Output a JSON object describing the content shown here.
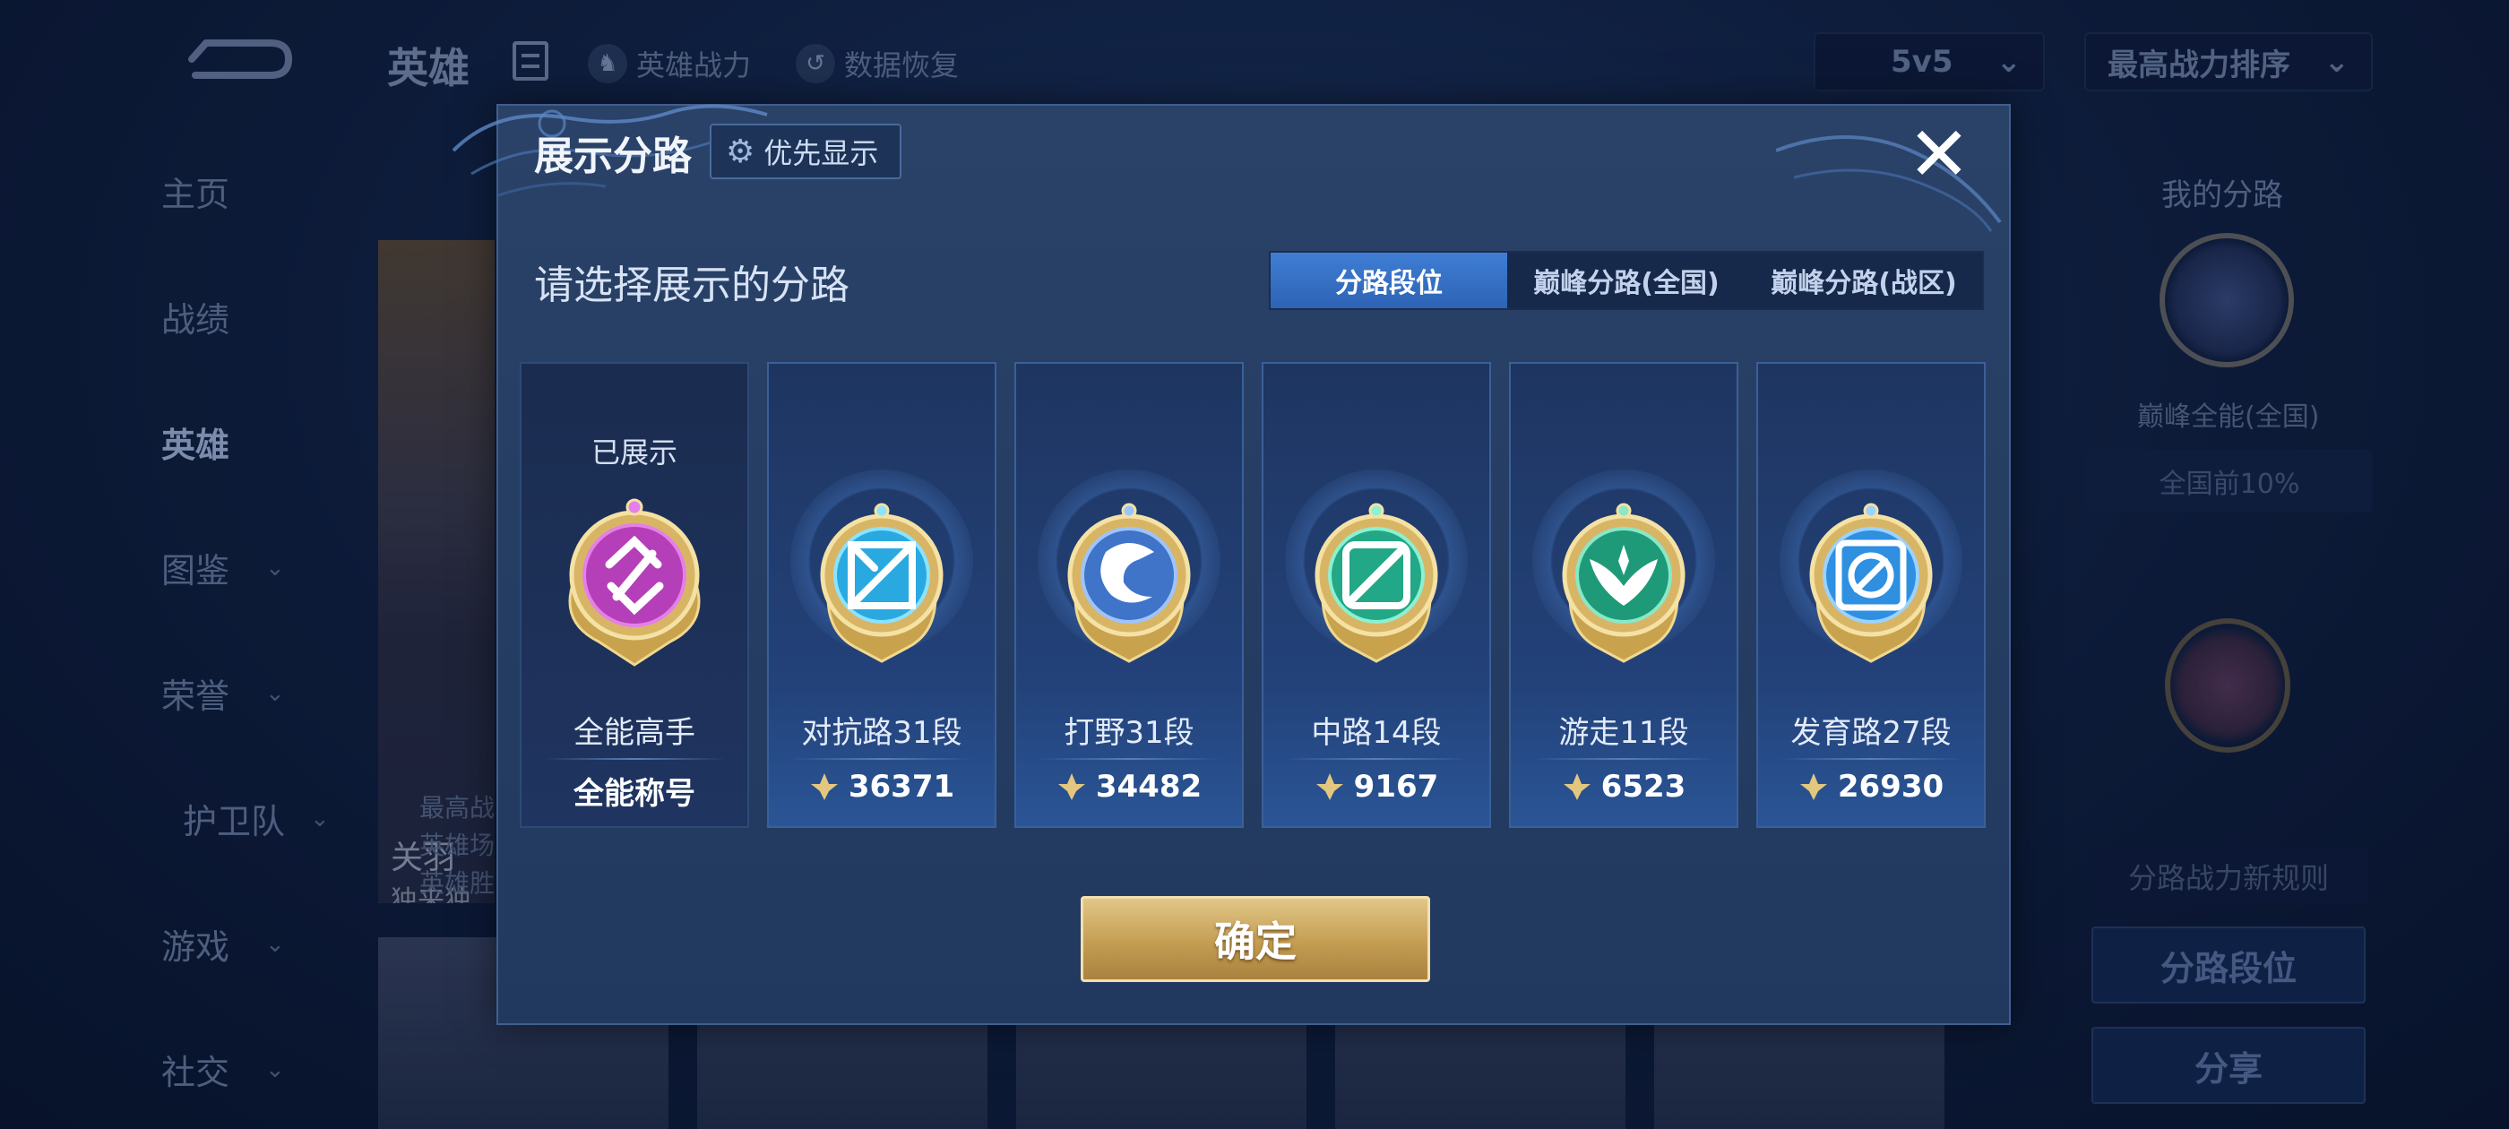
{
  "background": {
    "title": "英雄",
    "links": [
      "英雄战力",
      "数据恢复"
    ],
    "mode_select": "5v5",
    "sort_select": "最高战力排序",
    "nav": [
      {
        "label": "主页"
      },
      {
        "label": "战绩"
      },
      {
        "label": "英雄"
      },
      {
        "label": "图鉴"
      },
      {
        "label": "荣誉"
      },
      {
        "label": "护卫队"
      },
      {
        "label": "游戏"
      },
      {
        "label": "社交"
      }
    ],
    "hero_card": {
      "name": "关羽",
      "subtitle": "独来独往"
    },
    "hero_stats": [
      "最高战",
      "英雄场",
      "英雄胜"
    ],
    "right_panel": {
      "title": "我的分路",
      "badge_label": "巅峰全能(全国)",
      "rank_pill": "全国前10%",
      "rule_link": "分路战力新规则",
      "btn_lane_rank": "分路段位",
      "btn_share": "分享"
    }
  },
  "modal": {
    "title": "展示分路",
    "priority_button": "优先显示",
    "prompt": "请选择展示的分路",
    "tabs": [
      "分路段位",
      "巅峰分路(全国)",
      "巅峰分路(战区)"
    ],
    "active_tab": 0,
    "cards": [
      {
        "status": "已展示",
        "label": "全能高手",
        "value": "全能称号",
        "color": "#b53fb8",
        "icon": "all-round-medal-icon"
      },
      {
        "status": "",
        "label": "对抗路31段",
        "value": "36371",
        "color": "#2aa9e0",
        "icon": "clash-lane-medal-icon"
      },
      {
        "status": "",
        "label": "打野31段",
        "value": "34482",
        "color": "#3f74c8",
        "icon": "jungle-medal-icon"
      },
      {
        "status": "",
        "label": "中路14段",
        "value": "9167",
        "color": "#22a887",
        "icon": "mid-lane-medal-icon"
      },
      {
        "status": "",
        "label": "游走11段",
        "value": "6523",
        "color": "#1f9a78",
        "icon": "roam-medal-icon"
      },
      {
        "status": "",
        "label": "发育路27段",
        "value": "26930",
        "color": "#2f8fe0",
        "icon": "farm-lane-medal-icon"
      }
    ],
    "confirm": "确定"
  }
}
